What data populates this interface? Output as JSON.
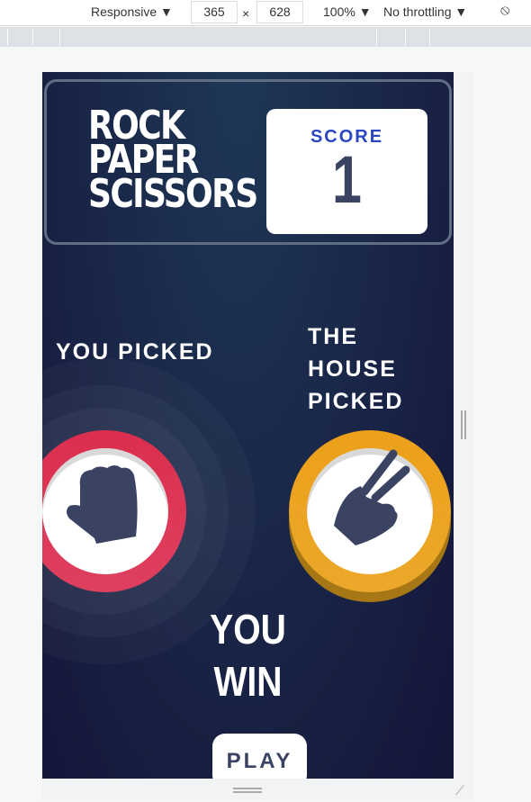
{
  "devtools": {
    "device": "Responsive ▼",
    "width": "365",
    "times": "×",
    "height": "628",
    "zoom": "100% ▼",
    "throttling": "No throttling ▼",
    "rotate_icon": "rotate-icon"
  },
  "game": {
    "title_lines": [
      "ROCK",
      "PAPER",
      "SCISSORS"
    ],
    "score_label": "SCORE",
    "score_value": "1",
    "you_picked": "YOU PICKED",
    "house_picked_1": "THE HOUSE",
    "house_picked_2": "PICKED",
    "player_choice": "rock",
    "house_choice": "scissors",
    "result_1": "YOU",
    "result_2": "WIN",
    "play_again": "PLAY",
    "colors": {
      "rock": "#dc2e4e",
      "scissors": "#eca922",
      "background": "#1f3756",
      "text_dark": "#3b4363",
      "score_blue": "#2a46c0"
    }
  }
}
